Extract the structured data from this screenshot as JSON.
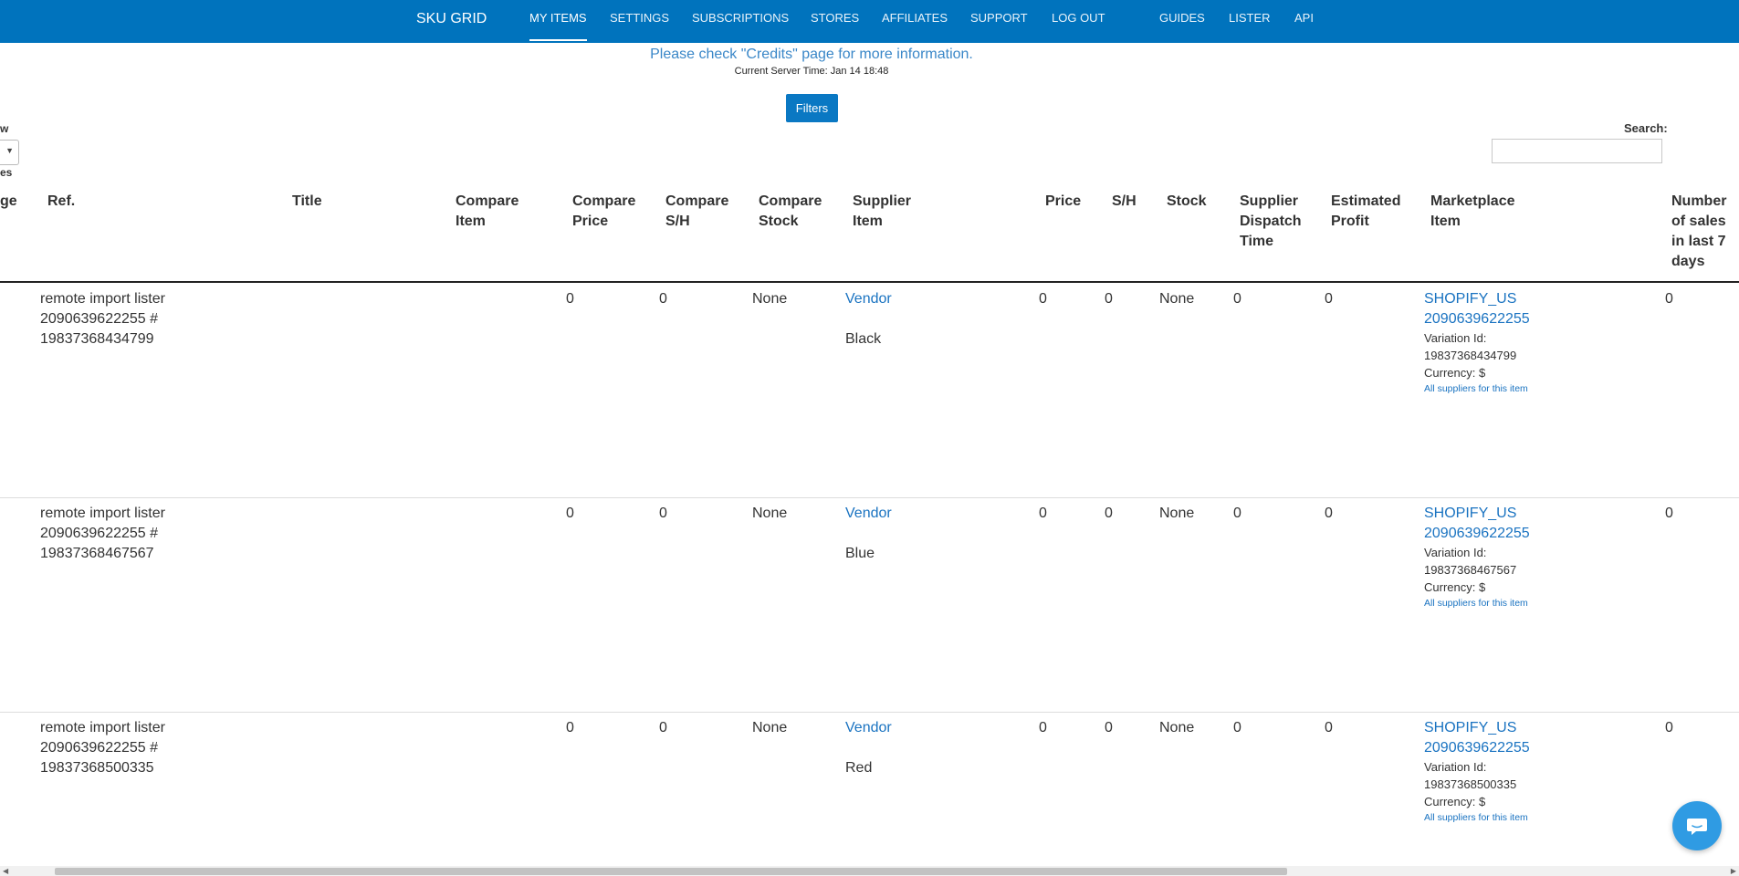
{
  "nav": {
    "brand": "SKU GRID",
    "items": [
      {
        "label": "MY ITEMS",
        "active": true
      },
      {
        "label": "SETTINGS"
      },
      {
        "label": "SUBSCRIPTIONS"
      },
      {
        "label": "STORES"
      },
      {
        "label": "AFFILIATES"
      },
      {
        "label": "SUPPORT"
      },
      {
        "label": "LOG OUT"
      },
      {
        "label": "GUIDES"
      },
      {
        "label": "LISTER"
      },
      {
        "label": "API"
      }
    ]
  },
  "notice": "Please check \"Credits\" page for more information.",
  "server_time": "Current Server Time: Jan 14 18:48",
  "filters_label": "Filters",
  "left_controls": {
    "show_fragment": "w",
    "entries_fragment": "es",
    "select_arrow": "▼"
  },
  "search": {
    "label": "Search:",
    "value": "",
    "placeholder": ""
  },
  "table": {
    "headers": {
      "image": [
        "ge"
      ],
      "ref": [
        "Ref."
      ],
      "title": [
        "Title"
      ],
      "compare_item": [
        "Compare",
        "Item"
      ],
      "compare_price": [
        "Compare",
        "Price"
      ],
      "compare_sh": [
        "Compare",
        "S/H"
      ],
      "compare_stock": [
        "Compare",
        "Stock"
      ],
      "supplier_item": [
        "Supplier",
        "Item"
      ],
      "price": [
        "Price"
      ],
      "sh": [
        "S/H"
      ],
      "stock": [
        "Stock"
      ],
      "dispatch": [
        "Supplier",
        "Dispatch",
        "Time"
      ],
      "profit": [
        "Estimated",
        "Profit"
      ],
      "marketplace": [
        "Marketplace",
        "Item"
      ],
      "sales": [
        "Number",
        "of sales",
        "in last 7",
        "days"
      ]
    },
    "rows": [
      {
        "ref": [
          "remote import lister",
          "2090639622255 #",
          "19837368434799"
        ],
        "compare_price": "0",
        "compare_sh": "0",
        "compare_stock": "None",
        "supplier_link": "Vendor",
        "variant": "Black",
        "price": "0",
        "sh": "0",
        "stock": "None",
        "dispatch": "0",
        "profit": "0",
        "marketplace_link": [
          "SHOPIFY_US",
          "2090639622255"
        ],
        "variation_label": "Variation Id:",
        "variation_id": "19837368434799",
        "currency": "Currency: $",
        "all_suppliers": "All suppliers for this item",
        "sales": "0"
      },
      {
        "ref": [
          "remote import lister",
          "2090639622255 #",
          "19837368467567"
        ],
        "compare_price": "0",
        "compare_sh": "0",
        "compare_stock": "None",
        "supplier_link": "Vendor",
        "variant": "Blue",
        "price": "0",
        "sh": "0",
        "stock": "None",
        "dispatch": "0",
        "profit": "0",
        "marketplace_link": [
          "SHOPIFY_US",
          "2090639622255"
        ],
        "variation_label": "Variation Id:",
        "variation_id": "19837368467567",
        "currency": "Currency: $",
        "all_suppliers": "All suppliers for this item",
        "sales": "0"
      },
      {
        "ref": [
          "remote import lister",
          "2090639622255 #",
          "19837368500335"
        ],
        "compare_price": "0",
        "compare_sh": "0",
        "compare_stock": "None",
        "supplier_link": "Vendor",
        "variant": "Red",
        "price": "0",
        "sh": "0",
        "stock": "None",
        "dispatch": "0",
        "profit": "0",
        "marketplace_link": [
          "SHOPIFY_US",
          "2090639622255"
        ],
        "variation_label": "Variation Id:",
        "variation_id": "19837368500335",
        "currency": "Currency: $",
        "all_suppliers": "All suppliers for this item",
        "sales": "0"
      }
    ]
  },
  "chat": {
    "icon": "chat-icon"
  },
  "colors": {
    "navbar": "#0073bd",
    "link": "#1a73c1",
    "button": "#0a78c3",
    "chat": "#2f9be3"
  }
}
